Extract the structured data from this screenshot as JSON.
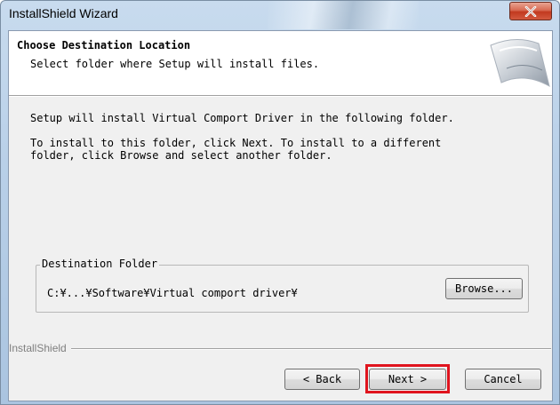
{
  "window": {
    "title": "InstallShield Wizard"
  },
  "header": {
    "title": "Choose Destination Location",
    "subtitle": "Select folder where Setup will install files."
  },
  "body": {
    "line1": "Setup will install Virtual Comport Driver in the following folder.",
    "line2": "To install to this folder, click Next. To install to a different",
    "line3": "folder, click Browse and select another folder."
  },
  "destination": {
    "group_label": "Destination Folder",
    "path": "C:¥...¥Software¥Virtual comport driver¥",
    "browse_label": "Browse..."
  },
  "footer": {
    "brand": "InstallShield",
    "back_label": "< Back",
    "next_label": "Next >",
    "cancel_label": "Cancel"
  },
  "colors": {
    "highlight": "#e0141e",
    "close_button": "#c2391f"
  }
}
